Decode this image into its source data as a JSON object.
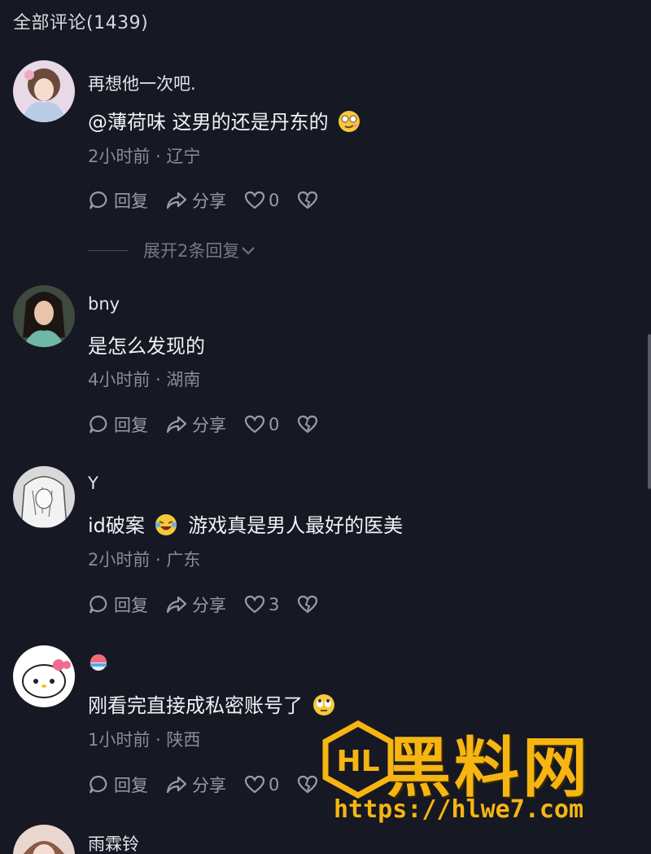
{
  "header": {
    "title": "全部评论(1439)"
  },
  "comments": [
    {
      "username": "再想他一次吧.",
      "text": "@薄荷味 这男的还是丹东的",
      "meta": "2小时前 · 辽宁",
      "reply_label": "回复",
      "share_label": "分享",
      "like_count": "0"
    },
    {
      "username": "bny",
      "text": "是怎么发现的",
      "meta": "4小时前 · 湖南",
      "reply_label": "回复",
      "share_label": "分享",
      "like_count": "0"
    },
    {
      "username": "Y",
      "text_a": "id破案",
      "text_b": "游戏真是男人最好的医美",
      "meta": "2小时前 · 广东",
      "reply_label": "回复",
      "share_label": "分享",
      "like_count": "3"
    },
    {
      "username": "",
      "text": "刚看完直接成私密账号了",
      "meta": "1小时前 · 陕西",
      "reply_label": "回复",
      "share_label": "分享",
      "like_count": "0"
    },
    {
      "username": "雨霖铃"
    }
  ],
  "expand_replies": "展开2条回复",
  "watermark": {
    "brand": "黑料网",
    "url": "https://hlwe7.com",
    "logo_text": "HL"
  },
  "colors": {
    "background": "#161823",
    "accent": "#f6b511",
    "muted": "#8b8c94"
  }
}
